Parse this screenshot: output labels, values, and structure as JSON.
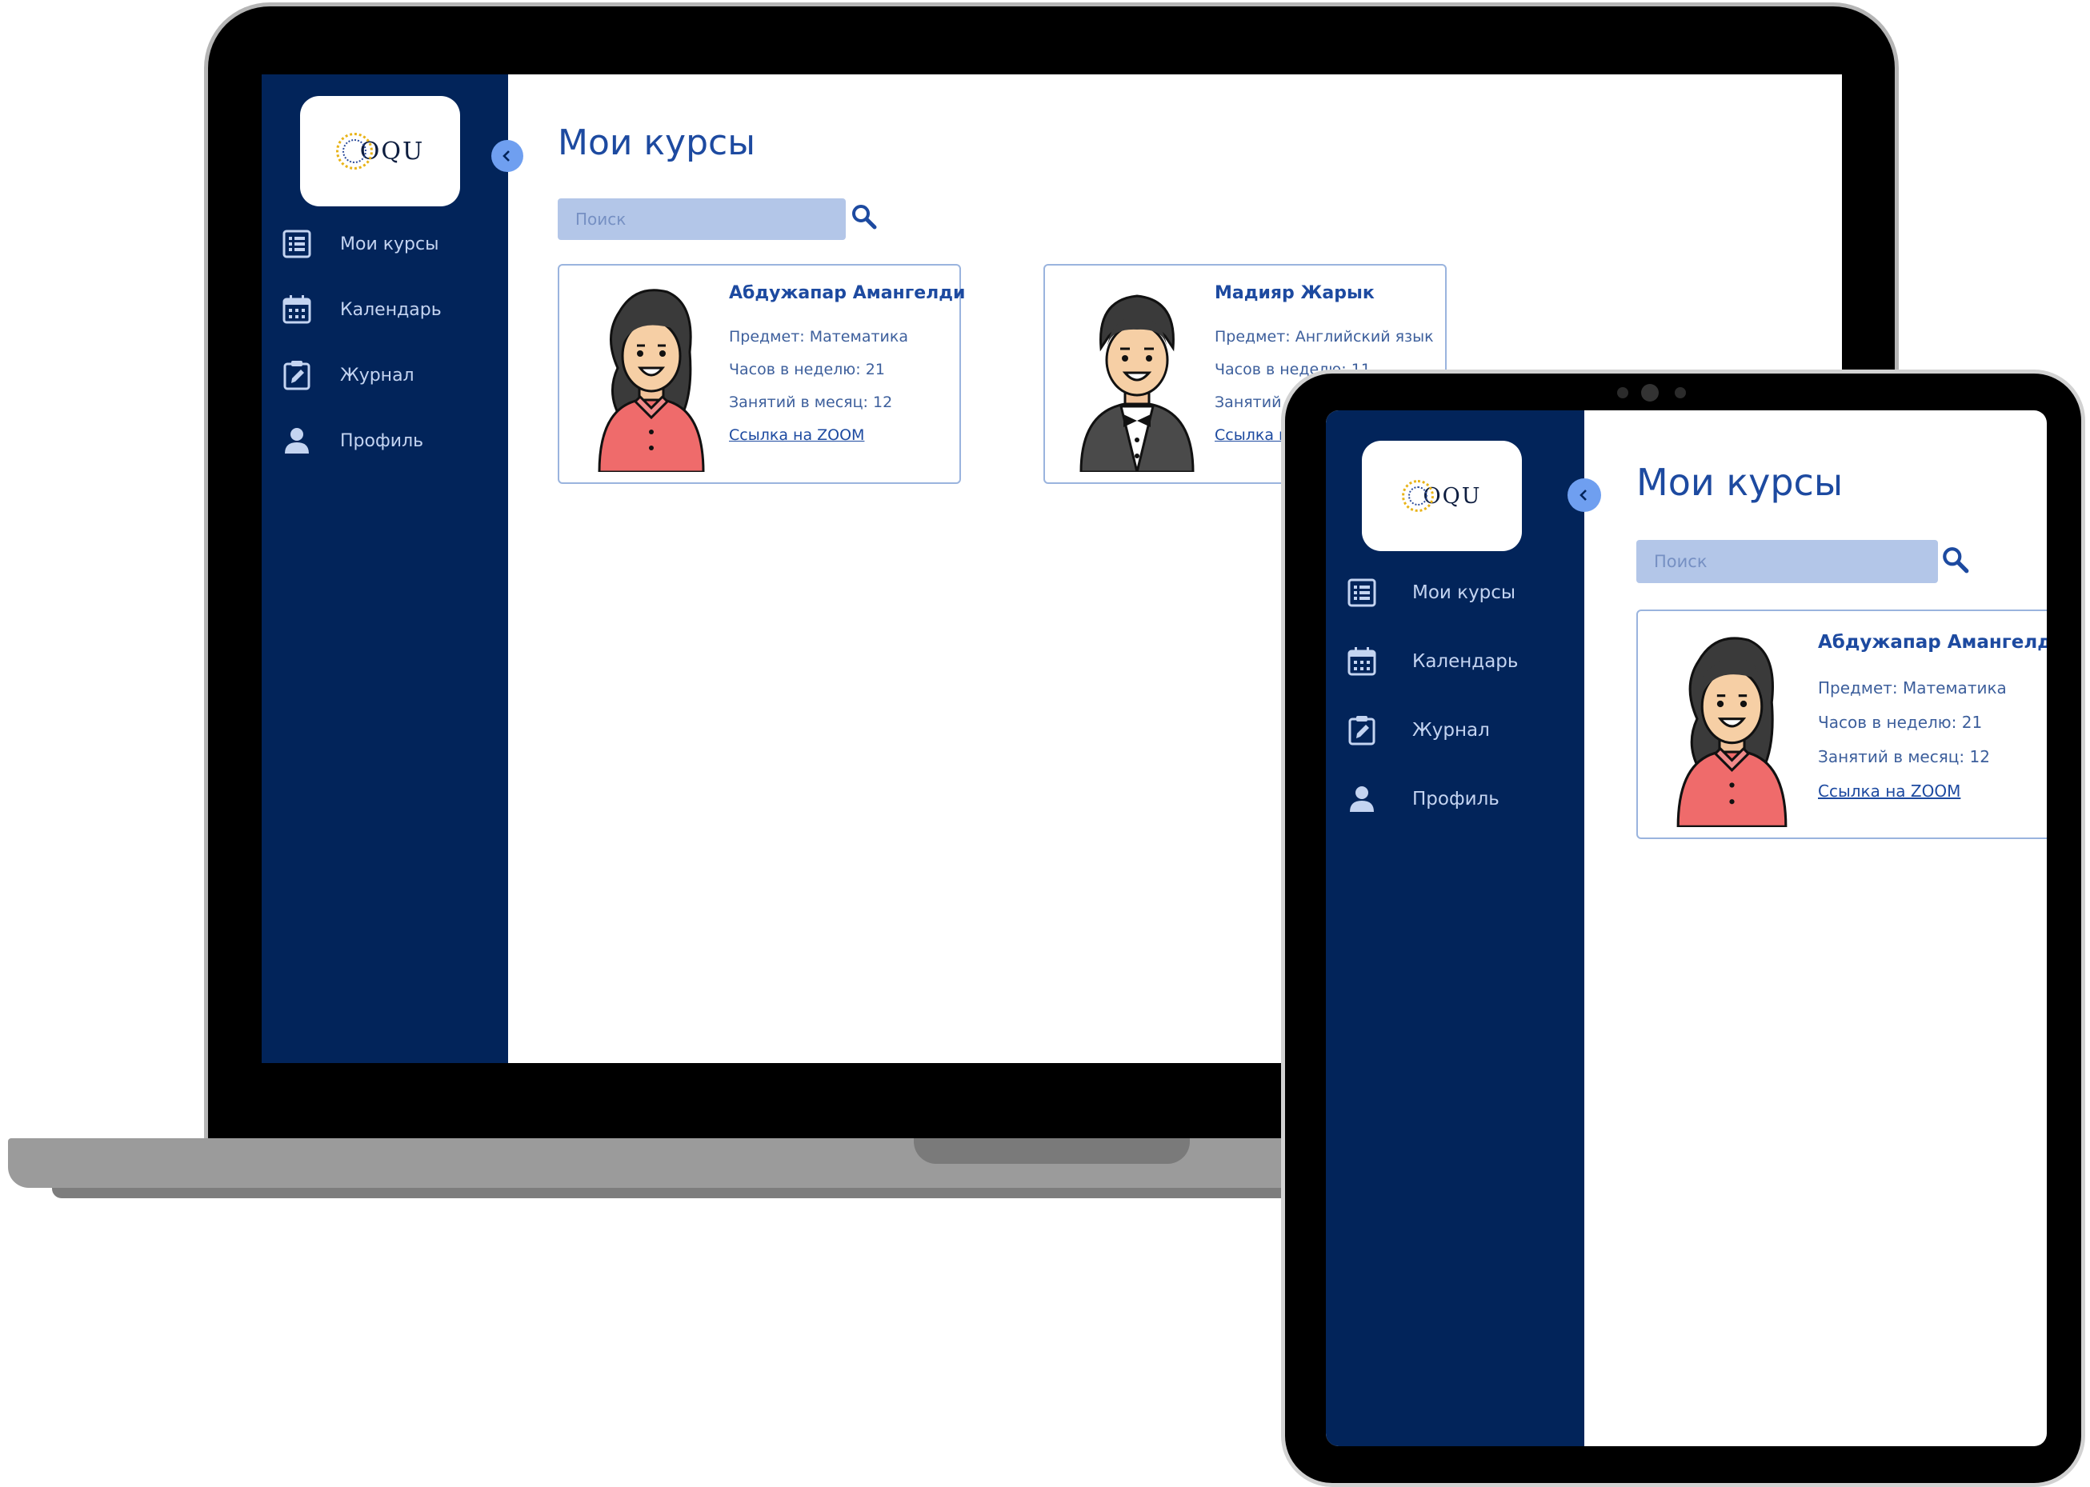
{
  "app": {
    "logo_text": "OQU",
    "page_title": "Мои курсы",
    "collapse_icon": "chevron-left-icon",
    "nav": [
      {
        "label": "Мои курсы",
        "icon": "list-icon"
      },
      {
        "label": "Календарь",
        "icon": "calendar-icon"
      },
      {
        "label": "Журнал",
        "icon": "clipboard-edit-icon"
      },
      {
        "label": "Профиль",
        "icon": "user-icon"
      }
    ],
    "search": {
      "placeholder": "Поиск",
      "icon": "search-icon"
    },
    "courses": [
      {
        "teacher": "Абдужапар Амангелди",
        "subject": "Предмет: Математика",
        "hours": "Часов в неделю: 21",
        "lessons": "Занятий в месяц: 12",
        "link": "Ссылка на ZOOM",
        "avatar": "woman-teacher-avatar"
      },
      {
        "teacher": "Мадияр Жарык",
        "subject": "Предмет: Английский язык",
        "hours": "Часов в неделю: 11",
        "lessons": "Занятий в месяц: 12",
        "link": "Ссылка на ZOOM",
        "avatar": "man-teacher-avatar"
      }
    ]
  },
  "colors": {
    "sidebar": "#02245a",
    "accent": "#1d4aa0",
    "search_bg": "#b3c6e8",
    "card_border": "#9ab4de",
    "logo_gold": "#e8b317"
  }
}
